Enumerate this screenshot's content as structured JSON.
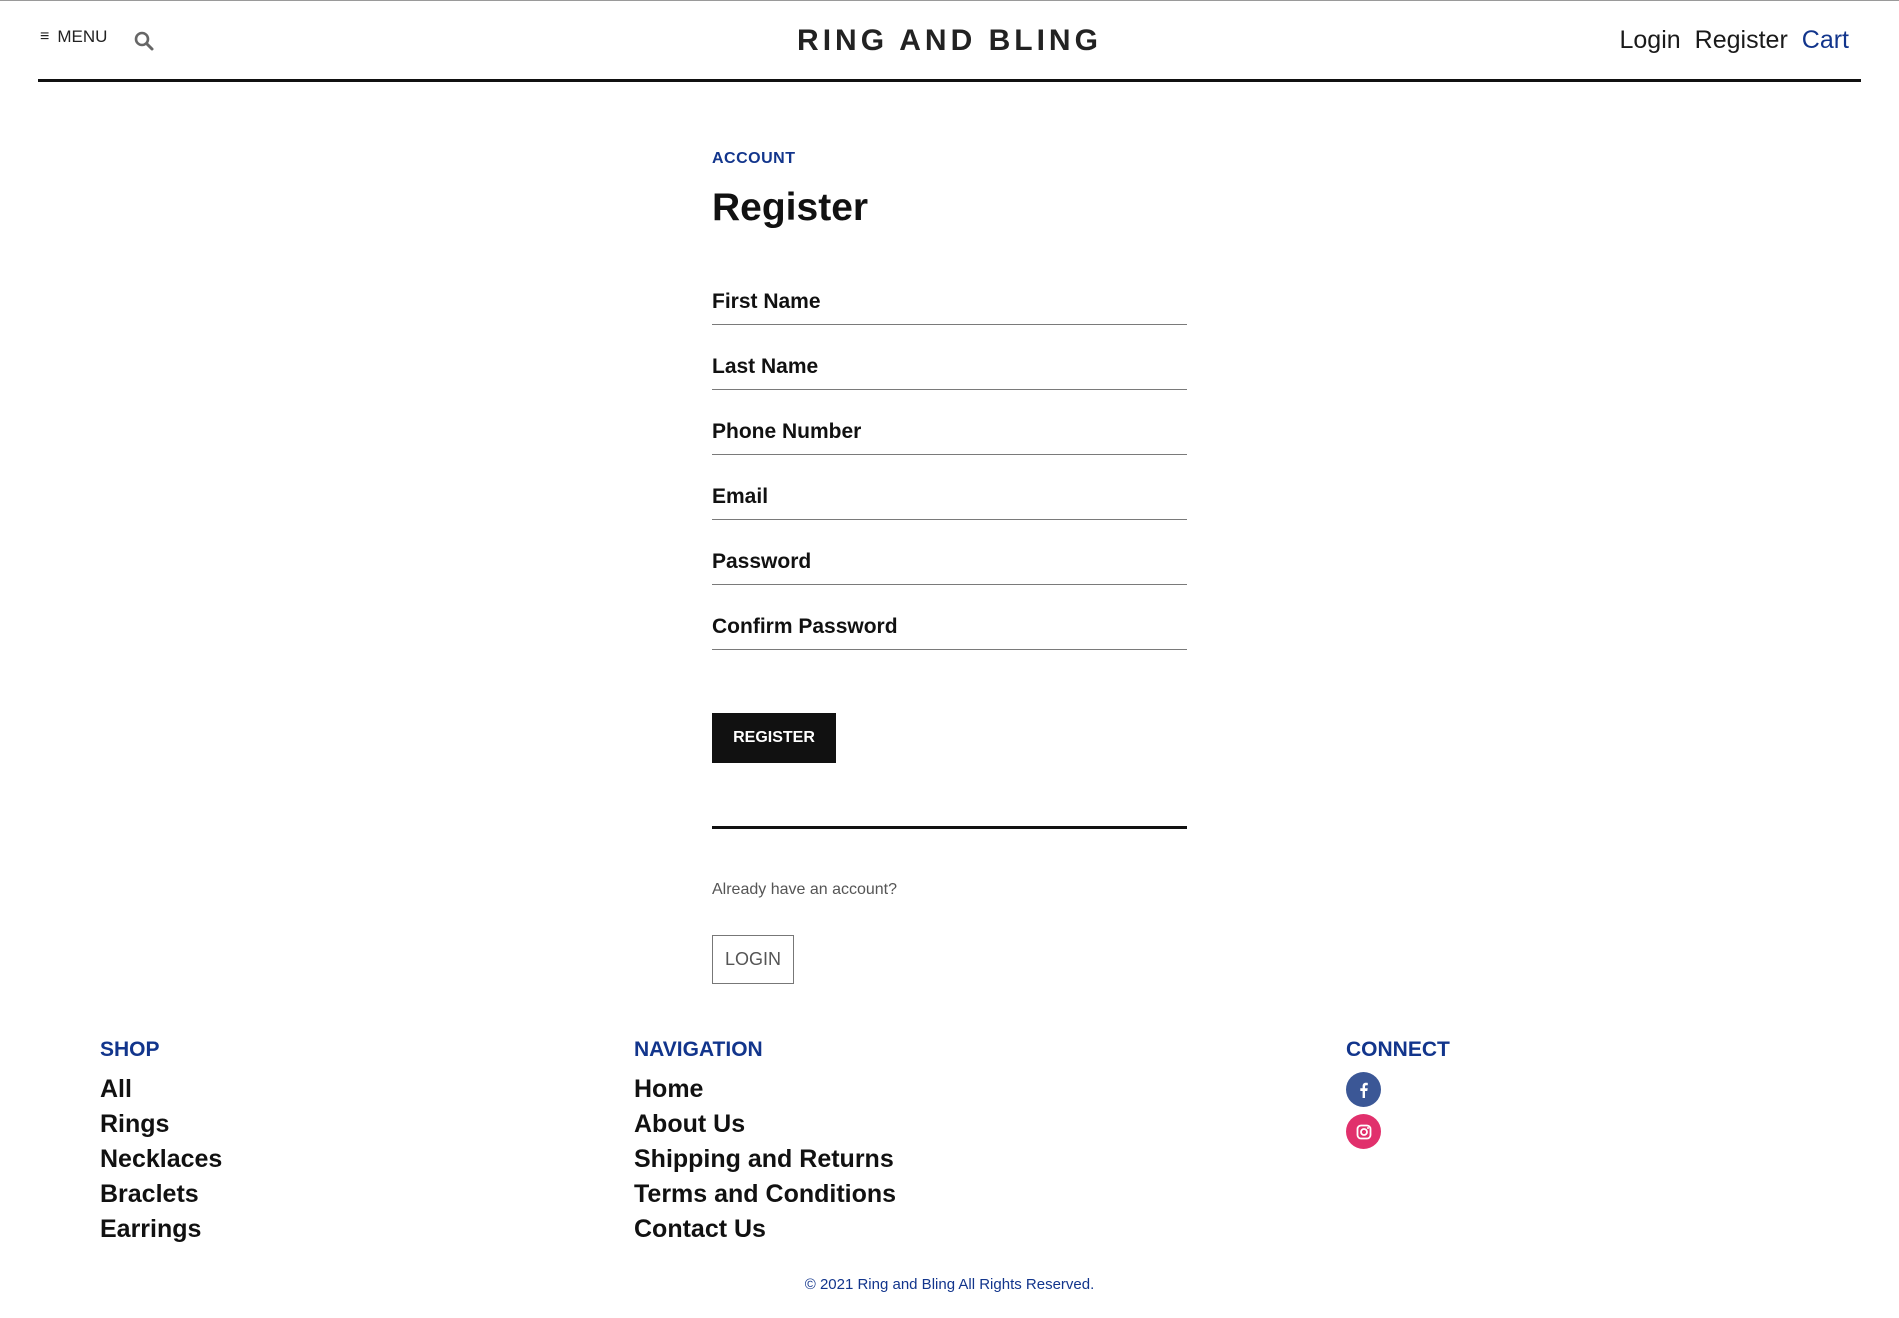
{
  "header": {
    "menu_label": "MENU",
    "menu_icon": "hamburger-icon",
    "search_icon": "search-icon",
    "brand": "RING AND BLING",
    "links": {
      "login": "Login",
      "register": "Register",
      "cart": "Cart"
    }
  },
  "form": {
    "eyebrow": "ACCOUNT",
    "title": "Register",
    "fields": {
      "first_name": "First Name",
      "last_name": "Last Name",
      "phone": "Phone Number",
      "email": "Email",
      "password": "Password",
      "confirm_password": "Confirm Password"
    },
    "register_button": "REGISTER",
    "already_text": "Already have an account?",
    "login_button": "LOGIN"
  },
  "footer": {
    "shop": {
      "heading": "SHOP",
      "items": [
        "All",
        "Rings",
        "Necklaces",
        "Braclets",
        "Earrings"
      ]
    },
    "navigation": {
      "heading": "NAVIGATION",
      "items": [
        "Home",
        "About Us",
        "Shipping and Returns",
        "Terms and Conditions",
        "Contact Us"
      ]
    },
    "connect": {
      "heading": "CONNECT",
      "icons": [
        "facebook-icon",
        "instagram-icon"
      ]
    },
    "copyright": "© 2021 Ring and Bling All Rights Reserved."
  },
  "colors": {
    "accent": "#12358c",
    "facebook": "#3b5796",
    "instagram": "#e1306c",
    "button_dark": "#111111"
  }
}
